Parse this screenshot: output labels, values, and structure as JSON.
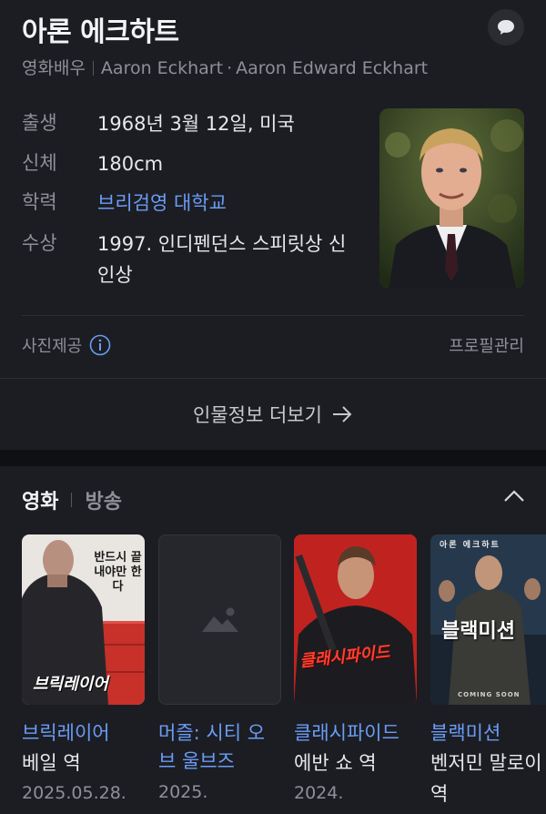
{
  "person": {
    "name": "아론 에크하트",
    "occupation": "영화배우",
    "name_en": "Aaron Eckhart",
    "name_full": "Aaron Edward Eckhart"
  },
  "info": [
    {
      "key": "출생",
      "value": "1968년 3월 12일, 미국"
    },
    {
      "key": "신체",
      "value": "180cm"
    },
    {
      "key": "학력",
      "value": "브리검영 대학교"
    },
    {
      "key": "수상",
      "value": "1997. 인디펜던스 스피릿상 신인상"
    }
  ],
  "photo_credit_label": "사진제공",
  "profile_manage_label": "프로필관리",
  "more_info_label": "인물정보 더보기",
  "filmography": {
    "tabs": [
      "영화",
      "방송"
    ],
    "movies": [
      {
        "title": "브릭레이어",
        "role": "베일 역",
        "date": "2025.05.28."
      },
      {
        "title": "머즐: 시티 오브 울브즈",
        "title_line1": "머즐: 시티 오",
        "title_line2": "브 울브즈",
        "role": "",
        "date": "2025."
      },
      {
        "title": "클래시파이드",
        "role": "에반 쇼 역",
        "date": "2024."
      },
      {
        "title": "블랙미션",
        "role": "벤저민 말로이",
        "role_cont": "역",
        "date": ""
      }
    ]
  },
  "poster_texts": {
    "p1_tagline": "반드시 끝내야만 한다",
    "p1_logo": "브릭레이어",
    "p3_logo": "클래시파이드",
    "p4_logo": "블랙미션",
    "p4_top": "아론 에크하트",
    "p4_bottom": "COMING SOON"
  },
  "colors": {
    "background": "#1c1d22",
    "link": "#6a9cf6",
    "muted": "#8e9098"
  }
}
